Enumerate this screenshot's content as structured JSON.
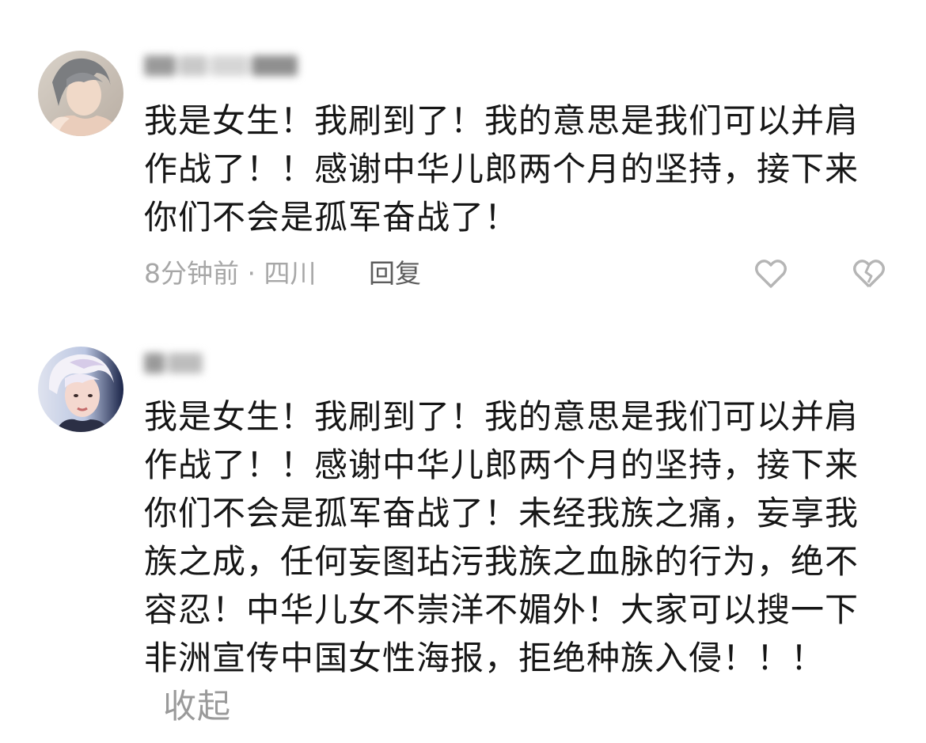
{
  "comments": [
    {
      "username": "王**",
      "text": "我是女生！我刷到了！我的意思是我们可以并肩作战了！！感谢中华儿郎两个月的坚持，接下来你们不会是孤军奋战了！",
      "time": "8分钟前",
      "location": "四川",
      "reply_label": "回复"
    },
    {
      "username": "**",
      "text": "我是女生！我刷到了！我的意思是我们可以并肩作战了！！感谢中华儿郎两个月的坚持，接下来你们不会是孤军奋战了！未经我族之痛，妄享我族之成，任何妄图玷污我族之血脉的行为，绝不容忍！中华儿女不崇洋不媚外！大家可以搜一下非洲宣传中国女性海报，拒绝种族入侵！！！",
      "collapse_label": "收起"
    }
  ],
  "icons": [
    "heart-outline-icon",
    "broken-heart-icon"
  ],
  "colors": {
    "text": "#161616",
    "meta": "#a7a7a7",
    "reply": "#5d5d5d",
    "collapse": "#9a9a9a",
    "icon": "#b5b5b5"
  }
}
